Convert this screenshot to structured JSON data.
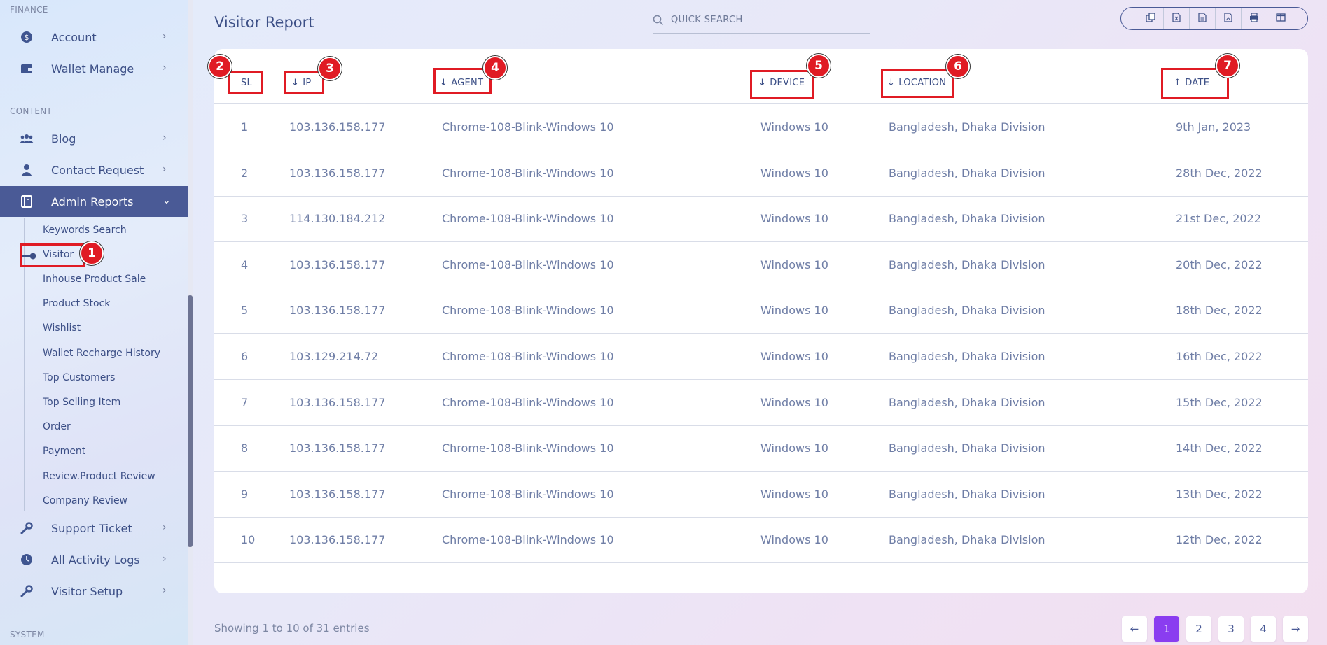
{
  "sidebar": {
    "sections": {
      "finance": "FINANCE",
      "content": "CONTENT",
      "system": "SYSTEM"
    },
    "items": {
      "account": "Account",
      "wallet_manage": "Wallet Manage",
      "blog": "Blog",
      "contact_request": "Contact Request",
      "admin_reports": "Admin Reports",
      "support_ticket": "Support Ticket",
      "all_activity_logs": "All Activity Logs",
      "visitor_setup": "Visitor Setup"
    },
    "submenu": [
      "Keywords Search",
      "Visitor",
      "Inhouse Product Sale",
      "Product Stock",
      "Wishlist",
      "Wallet Recharge History",
      "Top Customers",
      "Top Selling Item",
      "Order",
      "Payment",
      "Review.Product Review",
      "Company Review"
    ]
  },
  "header": {
    "title": "Visitor Report",
    "search_placeholder": "QUICK SEARCH"
  },
  "table": {
    "columns": {
      "sl": "SL",
      "ip": "IP",
      "agent": "AGENT",
      "device": "DEVICE",
      "location": "LOCATION",
      "date": "DATE"
    },
    "rows": [
      {
        "sl": "1",
        "ip": "103.136.158.177",
        "agent": "Chrome-108-Blink-Windows 10",
        "device": "Windows 10",
        "location": "Bangladesh, Dhaka Division",
        "date": "9th Jan, 2023"
      },
      {
        "sl": "2",
        "ip": "103.136.158.177",
        "agent": "Chrome-108-Blink-Windows 10",
        "device": "Windows 10",
        "location": "Bangladesh, Dhaka Division",
        "date": "28th Dec, 2022"
      },
      {
        "sl": "3",
        "ip": "114.130.184.212",
        "agent": "Chrome-108-Blink-Windows 10",
        "device": "Windows 10",
        "location": "Bangladesh, Dhaka Division",
        "date": "21st Dec, 2022"
      },
      {
        "sl": "4",
        "ip": "103.136.158.177",
        "agent": "Chrome-108-Blink-Windows 10",
        "device": "Windows 10",
        "location": "Bangladesh, Dhaka Division",
        "date": "20th Dec, 2022"
      },
      {
        "sl": "5",
        "ip": "103.136.158.177",
        "agent": "Chrome-108-Blink-Windows 10",
        "device": "Windows 10",
        "location": "Bangladesh, Dhaka Division",
        "date": "18th Dec, 2022"
      },
      {
        "sl": "6",
        "ip": "103.129.214.72",
        "agent": "Chrome-108-Blink-Windows 10",
        "device": "Windows 10",
        "location": "Bangladesh, Dhaka Division",
        "date": "16th Dec, 2022"
      },
      {
        "sl": "7",
        "ip": "103.136.158.177",
        "agent": "Chrome-108-Blink-Windows 10",
        "device": "Windows 10",
        "location": "Bangladesh, Dhaka Division",
        "date": "15th Dec, 2022"
      },
      {
        "sl": "8",
        "ip": "103.136.158.177",
        "agent": "Chrome-108-Blink-Windows 10",
        "device": "Windows 10",
        "location": "Bangladesh, Dhaka Division",
        "date": "14th Dec, 2022"
      },
      {
        "sl": "9",
        "ip": "103.136.158.177",
        "agent": "Chrome-108-Blink-Windows 10",
        "device": "Windows 10",
        "location": "Bangladesh, Dhaka Division",
        "date": "13th Dec, 2022"
      },
      {
        "sl": "10",
        "ip": "103.136.158.177",
        "agent": "Chrome-108-Blink-Windows 10",
        "device": "Windows 10",
        "location": "Bangladesh, Dhaka Division",
        "date": "12th Dec, 2022"
      }
    ]
  },
  "footer": {
    "showing": "Showing 1 to 10 of 31 entries",
    "pages": [
      "1",
      "2",
      "3",
      "4"
    ],
    "current_page": "1"
  },
  "annotations": [
    "1",
    "2",
    "3",
    "4",
    "5",
    "6",
    "7"
  ],
  "colors": {
    "accent": "#4a5a96",
    "active_page": "#8a3df0",
    "annotation": "#e01b24"
  }
}
